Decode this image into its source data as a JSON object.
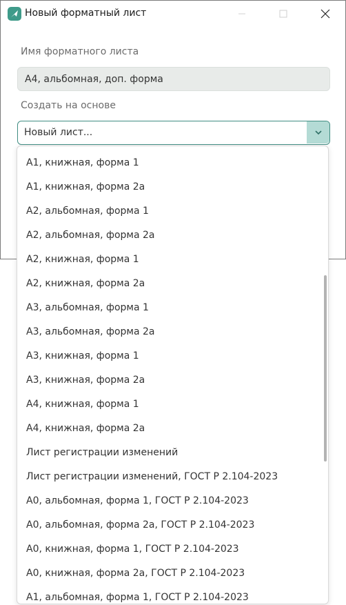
{
  "window": {
    "title": "Новый форматный лист",
    "icons": {
      "app": "app-logo-icon",
      "minimize": "minimize-icon",
      "maximize": "maximize-icon",
      "close": "close-icon"
    }
  },
  "form": {
    "name_label": "Имя форматного листа",
    "name_value": "А4, альбомная, доп. форма",
    "base_label": "Создать на основе",
    "base_value": "Новый лист..."
  },
  "dropdown": {
    "options": [
      "А1, книжная, форма 1",
      "А1, книжная, форма 2а",
      "А2, альбомная, форма 1",
      "А2, альбомная, форма 2а",
      "А2, книжная, форма 1",
      "А2, книжная, форма 2а",
      "А3, альбомная, форма 1",
      "А3, альбомная, форма 2а",
      "А3, книжная, форма 1",
      "А3, книжная, форма 2а",
      "А4, книжная, форма 1",
      "А4, книжная, форма 2а",
      "Лист регистрации изменений",
      "Лист регистрации изменений, ГОСТ Р 2.104-2023",
      "А0, альбомная, форма 1, ГОСТ Р 2.104-2023",
      "А0, альбомная, форма 2а, ГОСТ Р 2.104-2023",
      "А0, книжная, форма 1, ГОСТ Р 2.104-2023",
      "А0, книжная, форма 2а, ГОСТ Р 2.104-2023",
      "А1, альбомная, форма 1, ГОСТ Р 2.104-2023"
    ]
  },
  "colors": {
    "accent": "#3f8c82",
    "accent_light": "#b4dbd5",
    "input_bg": "#e8ebe9"
  }
}
